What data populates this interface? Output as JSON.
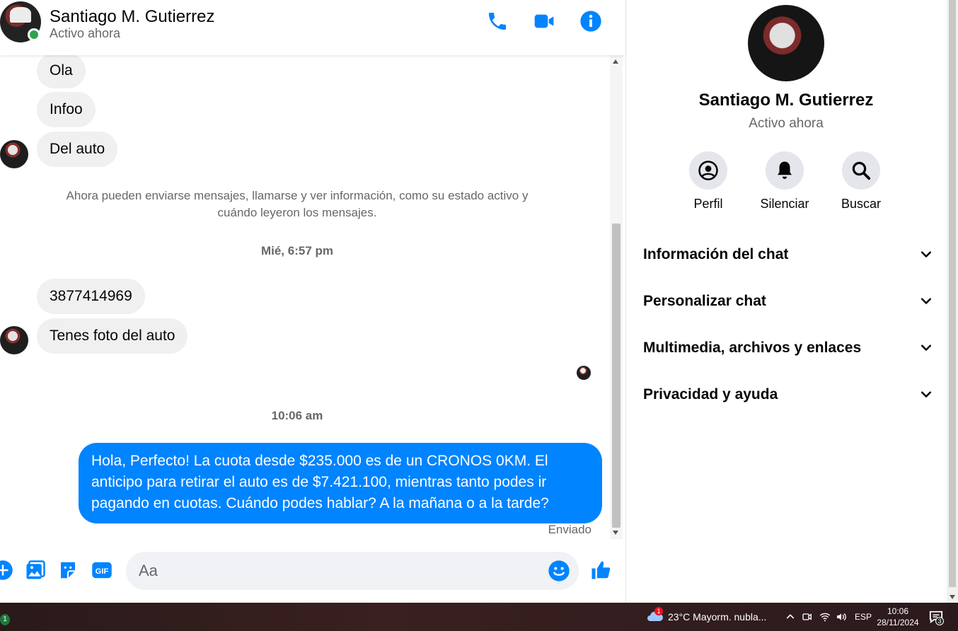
{
  "header": {
    "name": "Santiago M. Gutierrez",
    "status": "Activo ahora"
  },
  "messages": {
    "received_1": [
      "Ola",
      "Infoo",
      "Del auto"
    ],
    "system_note": "Ahora pueden enviarse mensajes, llamarse y ver información, como su estado activo y cuándo leyeron los mensajes.",
    "time_1": "Mié, 6:57 pm",
    "received_2": [
      "3877414969",
      "Tenes foto del auto"
    ],
    "time_2": "10:06 am",
    "sent": "Hola, Perfecto! La cuota desde $235.000 es de un CRONOS 0KM. El anticipo para retirar el auto es de $7.421.100, mientras tanto podes ir pagando en cuotas. Cuándo podes hablar? A la mañana o a la tarde?",
    "sent_status": "Enviado"
  },
  "composer": {
    "placeholder": "Aa"
  },
  "info_panel": {
    "name": "Santiago M. Gutierrez",
    "status": "Activo ahora",
    "actions": [
      "Perfil",
      "Silenciar",
      "Buscar"
    ],
    "sections": [
      "Información del chat",
      "Personalizar chat",
      "Multimedia, archivos y enlaces",
      "Privacidad y ayuda"
    ]
  },
  "taskbar": {
    "left_badge": "1",
    "weather_badge": "1",
    "weather": "23°C  Mayorm. nubla...",
    "language": "ESP",
    "time": "10:06",
    "date": "28/11/2024",
    "notification_count": "3"
  },
  "colors": {
    "accent": "#0084ff",
    "received_bubble": "#f0f0f0",
    "online": "#31a24c"
  }
}
